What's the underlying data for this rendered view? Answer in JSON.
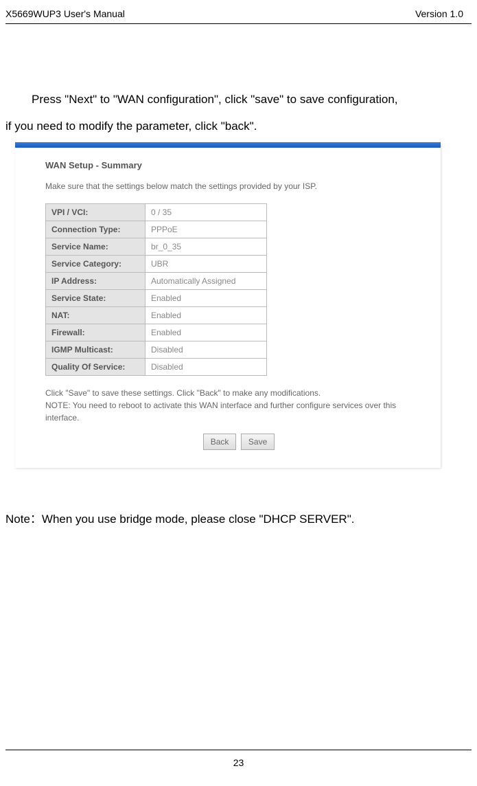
{
  "header": {
    "left": "X5669WUP3 User's Manual",
    "right": "Version 1.0"
  },
  "body": {
    "para1_line1": "Press \"Next\" to \"WAN configuration\", click \"save\" to save configuration,",
    "para1_line2": "if you need to modify the parameter, click \"back\".",
    "note": "Note：When you use bridge mode, please close \"DHCP SERVER\"."
  },
  "panel": {
    "title": "WAN Setup - Summary",
    "desc": "Make sure that the settings below match the settings provided by your ISP.",
    "rows": [
      {
        "label": "VPI / VCI:",
        "value": "0 / 35"
      },
      {
        "label": "Connection Type:",
        "value": "PPPoE"
      },
      {
        "label": "Service Name:",
        "value": "br_0_35"
      },
      {
        "label": "Service Category:",
        "value": "UBR"
      },
      {
        "label": "IP Address:",
        "value": "Automatically Assigned"
      },
      {
        "label": "Service State:",
        "value": "Enabled"
      },
      {
        "label": "NAT:",
        "value": "Enabled"
      },
      {
        "label": "Firewall:",
        "value": "Enabled"
      },
      {
        "label": "IGMP Multicast:",
        "value": "Disabled"
      },
      {
        "label": "Quality Of Service:",
        "value": "Disabled"
      }
    ],
    "note_line1": "Click \"Save\" to save these settings. Click \"Back\" to make any modifications.",
    "note_line2": "NOTE: You need to reboot to activate this WAN interface and further configure services over this interface.",
    "back_btn": "Back",
    "save_btn": "Save"
  },
  "footer": {
    "page": "23"
  }
}
